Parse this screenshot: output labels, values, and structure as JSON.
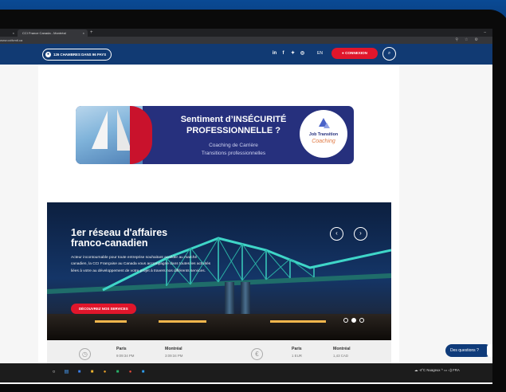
{
  "browser": {
    "tab_left_close": "×",
    "active_tab": "CCI France Canada - Montréal",
    "tab_close": "×",
    "new_tab": "+",
    "window_minimize": "–",
    "url": "www.ccifcmtl.ca"
  },
  "nav": {
    "chambers_label": "126 CHAMBRES DANS 96 PAYS",
    "language": "EN",
    "login_label": "CONNEXION",
    "social_icons": [
      "linkedin-icon",
      "facebook-icon",
      "twitter-icon",
      "instagram-icon"
    ]
  },
  "banner": {
    "title_line1": "Sentiment d’INSÉCURITÉ",
    "title_line2": "PROFESSIONNELLE ?",
    "sub_line1": "Coaching de Carrière",
    "sub_line2": "Transitions professionnelles",
    "badge_line1": "Job Transition",
    "badge_line2": "Coaching"
  },
  "hero": {
    "title_line1": "1er réseau d'affaires",
    "title_line2": "franco-canadien",
    "description": "Acteur incontournable pour toute entreprise souhaitant accéder au marché canadien, la CCI Française au Canada vous accompagne dans toutes les activités liées à votre au développement de votre projet à travers nos différents services.",
    "cta_label": "DÉCOUVREZ NOS SERVICES",
    "prev_label": "‹",
    "next_label": "›"
  },
  "infobar": {
    "time": [
      {
        "city": "Paris",
        "value": "9:09:34 PM"
      },
      {
        "city": "Montréal",
        "value": "3:09:34 PM"
      }
    ],
    "currency": [
      {
        "city": "Paris",
        "value": "1 EUR"
      },
      {
        "city": "Montréal",
        "value": "1,43 CAD"
      }
    ],
    "currency_symbol": "€"
  },
  "chat": {
    "label": "Des questions ?"
  },
  "taskbar": {
    "weather": "-4°C  Nuageux",
    "lang": "FRA"
  },
  "colors": {
    "navy": "#113a73",
    "red": "#e0162b",
    "banner_blue": "#26307d"
  }
}
